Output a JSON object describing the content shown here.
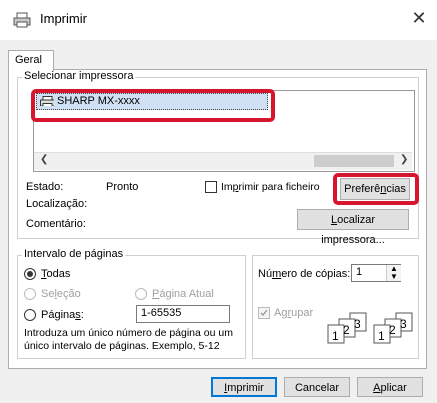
{
  "window": {
    "title": "Imprimir",
    "close_glyph": "✕"
  },
  "tabs": [
    {
      "label": "Geral"
    }
  ],
  "select_printer": {
    "group_label": "Selecionar impressora",
    "selected_printer": "SHARP MX-xxxx"
  },
  "status": {
    "estado_label": "Estado:",
    "estado_value": "Pronto",
    "localizacao_label": "Localização:",
    "comentario_label": "Comentário:",
    "print_to_file_pre": "Im",
    "print_to_file_u": "p",
    "print_to_file_post": "rimir para ficheiro",
    "preferences_pre": "Preferê",
    "preferences_u": "n",
    "preferences_post": "cias",
    "find_printer_u": "L",
    "find_printer_post": "ocalizar impressora..."
  },
  "page_range": {
    "group_label": "Intervalo de páginas",
    "all_u": "T",
    "all_post": "odas",
    "selection_pre": "Se",
    "selection_u": "l",
    "selection_post": "eção",
    "current_page_u": "P",
    "current_page_post": "ágina Atual",
    "pages_pre": "Página",
    "pages_u": "s",
    "pages_post": ":",
    "pages_value": "1-65535",
    "help_text_1": "Introduza um único número de página ou um",
    "help_text_2": "único intervalo de páginas. Exemplo, 5-12"
  },
  "copies": {
    "number_label_pre": "Nú",
    "number_label_u": "m",
    "number_label_post": "ero de cópias:",
    "number_value": "1",
    "collate_pre": "Ag",
    "collate_u": "r",
    "collate_post": "upar"
  },
  "footer": {
    "print_u": "I",
    "print_post": "mprimir",
    "cancel": "Cancelar",
    "apply_u": "A",
    "apply_post": "plicar"
  }
}
